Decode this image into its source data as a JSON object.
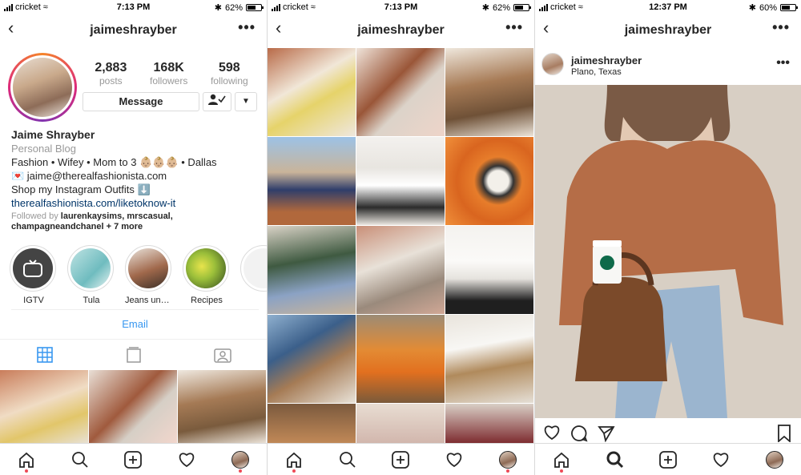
{
  "status": [
    {
      "carrier": "cricket",
      "time": "7:13 PM",
      "battery": "62%",
      "battery_level": 0.62
    },
    {
      "carrier": "cricket",
      "time": "7:13 PM",
      "battery": "62%",
      "battery_level": 0.62
    },
    {
      "carrier": "cricket",
      "time": "12:37 PM",
      "battery": "60%",
      "battery_level": 0.6
    }
  ],
  "header": {
    "username": "jaimeshrayber",
    "back_icon": "chevron-left-icon",
    "more_label": "•••"
  },
  "profile": {
    "stats": [
      {
        "value": "2,883",
        "label": "posts"
      },
      {
        "value": "168K",
        "label": "followers"
      },
      {
        "value": "598",
        "label": "following"
      }
    ],
    "message_label": "Message",
    "name": "Jaime Shrayber",
    "category": "Personal Blog",
    "bio_line1": "Fashion • Wifey • Mom to 3 👶🏼👶🏼👶🏼 • Dallas",
    "bio_line2": "💌 jaime@therealfashionista.com",
    "bio_line3": "Shop my Instagram Outfits ⬇️",
    "link": "therealfashionista.com/liketoknow-it",
    "followed_by_prefix": "Followed by",
    "followed_by_users": "laurenkaysims, mrscasual, champagneandchanel",
    "followed_by_more": "+ 7 more",
    "highlights": [
      {
        "label": "IGTV"
      },
      {
        "label": "Tula"
      },
      {
        "label": "Jeans unde..."
      },
      {
        "label": "Recipes"
      }
    ],
    "email_label": "Email"
  },
  "post": {
    "username": "jaimeshrayber",
    "location": "Plano, Texas",
    "more_label": "•••"
  },
  "colors": {
    "link": "#003569",
    "action_blue": "#3897f0",
    "notification_dot": "#ed4956"
  }
}
